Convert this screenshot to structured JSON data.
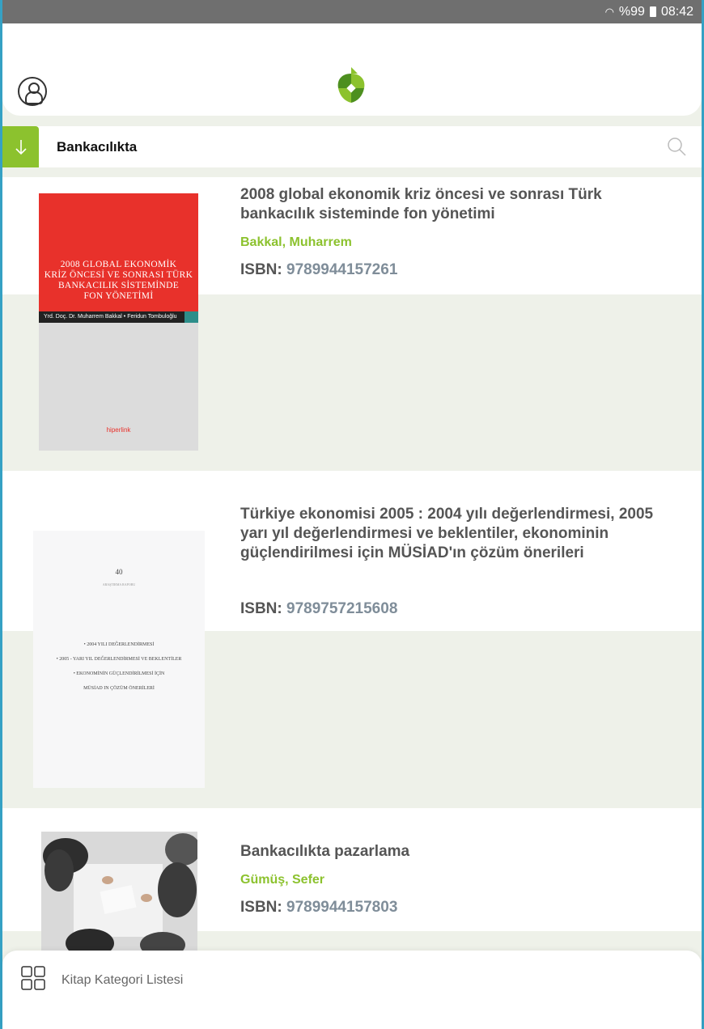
{
  "status_bar": {
    "battery": "%99",
    "time": "08:42",
    "wifi_icon": "wifi-icon"
  },
  "header": {
    "logo_icon": "app-logo-icon",
    "avatar_icon": "user-avatar-icon"
  },
  "category_bar": {
    "title": "Bankacılıkta",
    "toggle_icon": "arrow-down-icon",
    "search_icon": "search-icon"
  },
  "books": [
    {
      "title": "2008 global ekonomik kriz öncesi ve sonrası Türk bankacılık sisteminde fon yönetimi",
      "author": "Bakkal, Muharrem",
      "isbn_label": "ISBN:",
      "isbn": "9789944157261",
      "cover": {
        "title_lines": [
          "2008 GLOBAL EKONOMİK",
          "KRİZ ÖNCESİ VE SONRASI TÜRK",
          "BANKACILIK SİSTEMİNDE",
          "FON YÖNETİMİ"
        ],
        "authors": "Yrd. Doç. Dr. Muharrem Bakkal • Feridun Tombuloğlu",
        "publisher": "hiperlink"
      }
    },
    {
      "title": "Türkiye ekonomisi 2005 : 2004 yılı değerlendirmesi, 2005 yarı yıl değerlendirmesi ve beklentiler, ekonominin güçlendirilmesi için MÜSİAD'ın çözüm önerileri",
      "author": "",
      "isbn_label": "ISBN:",
      "isbn": "9789757215608",
      "cover": {
        "number": "40",
        "subtitle": "ARAŞTIRMA RAPORU",
        "lines": [
          "• 2004 YILI DEĞERLENDİRMESİ",
          "• 2005 - YARI YIL DEĞERLENDİRMESİ VE BEKLENTİLER",
          "• EKONOMİNİN GÜÇLENDİRİLMESİ İÇİN",
          "MÜSİAD IN ÇÖZÜM ÖNERİLERİ"
        ]
      }
    },
    {
      "title": "Bankacılıkta pazarlama",
      "author": "Gümüş, Sefer",
      "isbn_label": "ISBN:",
      "isbn": "9789944157803",
      "cover": {
        "image": "business-meeting-photo"
      }
    }
  ],
  "bottom_nav": {
    "label": "Kitap Kategori Listesi",
    "icon": "grid-icon"
  },
  "colors": {
    "accent": "#8cc22e",
    "isbn_value": "#7f8d99",
    "border": "#35a1c4"
  }
}
